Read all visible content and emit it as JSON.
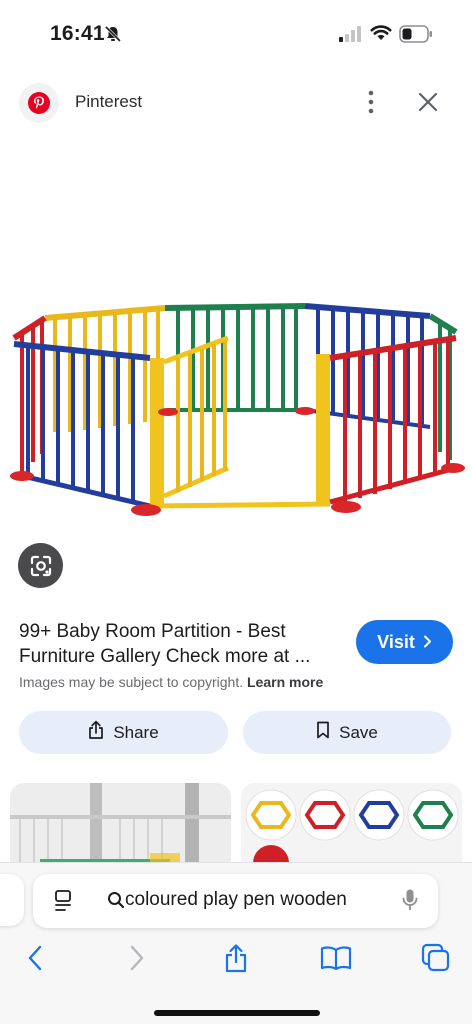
{
  "status_bar": {
    "time": "16:41",
    "icons": [
      "bell-slash-icon",
      "cellular-signal-icon",
      "wifi-icon",
      "battery-icon"
    ]
  },
  "source": {
    "name": "Pinterest",
    "logo_icon": "pinterest-logo",
    "menu_icon": "more-vertical-icon",
    "close_icon": "close-icon",
    "brand_color": "#e60023"
  },
  "image": {
    "alt_subject": "colourful octagonal wooden play pen",
    "lens_icon": "google-lens-icon"
  },
  "result": {
    "title_line1": "99+ Baby Room Partition - Best",
    "title_line2": "Furniture Gallery Check more at ...",
    "visit_label": "Visit",
    "visit_icon": "chevron-right-icon",
    "copyright_text": "Images may be subject to copyright.",
    "learn_more_label": "Learn more"
  },
  "actions": {
    "share_label": "Share",
    "share_icon": "share-icon",
    "save_label": "Save",
    "save_icon": "bookmark-icon"
  },
  "address_bar": {
    "query": "coloured play pen wooden",
    "left_icon": "page-format-icon",
    "search_icon": "search-icon",
    "mic_icon": "microphone-icon"
  },
  "toolbar": {
    "icons": [
      "back-icon",
      "forward-icon",
      "share-icon",
      "bookmarks-icon",
      "tabs-icon"
    ]
  },
  "colors": {
    "accent": "#1a73e8",
    "pill_bg": "#e7eefa"
  }
}
